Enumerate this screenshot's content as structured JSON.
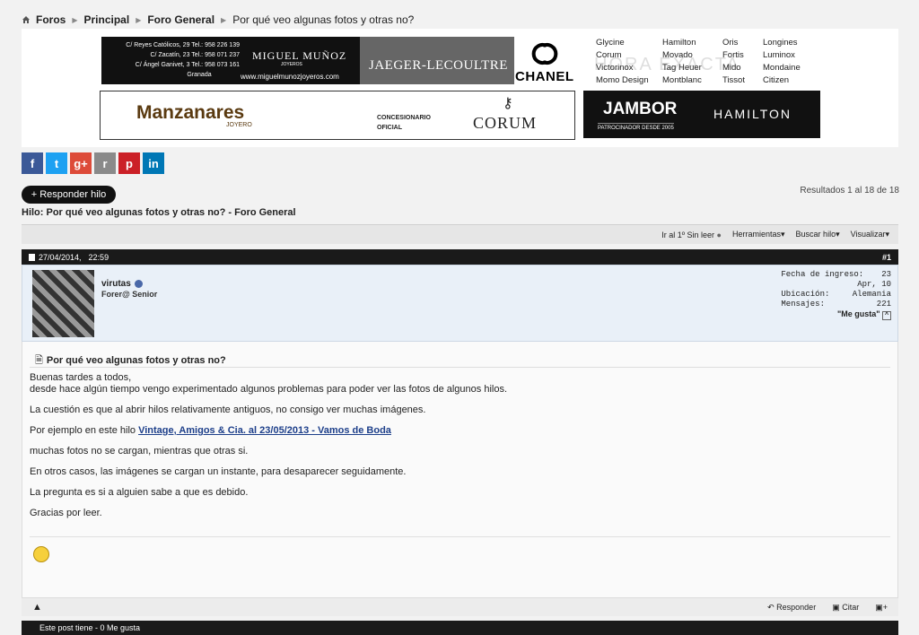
{
  "breadcrumb": {
    "items": [
      "Foros",
      "Principal",
      "Foro General"
    ],
    "current": "Por qué veo algunas fotos y otras no?"
  },
  "ads": {
    "ad1": {
      "address": [
        "C/ Reyes Católicos, 29 Tel.: 958 226 139",
        "C/ Zacatín, 23 Tel.: 958 071 237",
        "C/ Ángel Ganivet, 3 Tel.: 958 073 161",
        "Granada"
      ],
      "brand": "MIGUEL MUÑOZ",
      "sub": "JOYEROS",
      "web": "www.miguelmunozjoyeros.com"
    },
    "ad2": {
      "brand": "JAEGER-LECOULTRE"
    },
    "ad3": {
      "brand": "CHANEL"
    },
    "ad4": {
      "col1": [
        "Glycine",
        "Corum",
        "Victorinox",
        "Momo Design"
      ],
      "col2": [
        "Hamilton",
        "Movado",
        "Tag Heuer",
        "Montblanc"
      ],
      "col3": [
        "Oris",
        "Fortis",
        "Mido",
        "Tissot"
      ],
      "col4": [
        "Longines",
        "Luminox",
        "Mondaine",
        "Citizen"
      ],
      "watermark": "HORA EXACTA"
    },
    "ad5": {
      "brand": "Manzanares",
      "sub": "JOYERO",
      "conc_line1": "CONCESIONARIO",
      "conc_line2": "OFICIAL",
      "corum": "CORUM"
    },
    "ad6": {
      "jambor": "JAMBOR",
      "patrocinador": "PATROCINADOR DESDE 2005",
      "hamilton": "HAMILTON"
    }
  },
  "share": [
    {
      "label": "f",
      "color": "#3b5998"
    },
    {
      "label": "t",
      "color": "#1da1f2"
    },
    {
      "label": "g+",
      "color": "#dd4b39"
    },
    {
      "label": "r",
      "color": "#8a8a8a"
    },
    {
      "label": "p",
      "color": "#cb2027"
    },
    {
      "label": "in",
      "color": "#0077b5"
    }
  ],
  "reply_button": "+ Responder hilo",
  "results": "Resultados 1 al 18 de 18",
  "thread_title": "Hilo: Por qué veo algunas fotos y otras no? - Foro General",
  "toolbar": {
    "unread": "Ir al 1º Sin leer",
    "tools": "Herramientas",
    "search": "Buscar hilo",
    "view": "Visualizar"
  },
  "post": {
    "date": "27/04/2014,",
    "time": "22:59",
    "number": "#1",
    "username": "virutas",
    "rank": "Forer@ Senior",
    "info": {
      "joined_label": "Fecha de ingreso:",
      "joined_value": "23",
      "joined_value2": "Apr, 10",
      "location_label": "Ubicación:",
      "location_value": "Alemania",
      "posts_label": "Mensajes:",
      "posts_value": "221",
      "likes_label": "\"Me gusta\""
    },
    "title": "Por qué veo algunas fotos y otras no?",
    "lines": {
      "l1": "Buenas tardes a todos,",
      "l2": "desde hace algún tiempo vengo experimentado algunos problemas para poder ver las fotos de algunos hilos.",
      "l3": "La cuestión es que al abrir hilos relativamente antiguos, no consigo ver muchas imágenes.",
      "l4_prefix": "Por ejemplo en este hilo ",
      "l4_link": "Vintage, Amigos & Cia. al 23/05/2013 - Vamos de Boda",
      "l5": "muchas fotos no se cargan, mientras que otras si.",
      "l6": "En otros casos, las imágenes se cargan un instante, para desaparecer seguidamente.",
      "l7": "La pregunta es si a alguien sabe a que es debido.",
      "l8": "Gracias por leer."
    }
  },
  "actions": {
    "reply": "Responder",
    "quote": "Citar"
  },
  "footer": "Este post tiene - 0 Me gusta"
}
